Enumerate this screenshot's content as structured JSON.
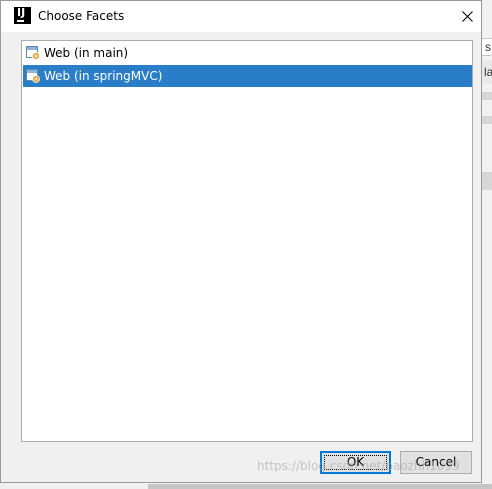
{
  "window": {
    "title": "Choose Facets",
    "app_icon": "intellij-idea-icon",
    "app_icon_text": "IJ"
  },
  "facets": [
    {
      "label": "Web (in main)",
      "icon": "web-facet-icon",
      "selected": false
    },
    {
      "label": "Web (in springMVC)",
      "icon": "web-facet-icon",
      "selected": true
    }
  ],
  "buttons": {
    "ok_label": "OK",
    "cancel_label": "Cancel"
  },
  "background_window": {
    "fragment_1": "s",
    "fragment_2": "la"
  },
  "watermark": "https://blog.csdn.net/baozhh1099",
  "colors": {
    "selection": "#2a7ec7",
    "default_button_border": "#0078d7",
    "dialog_background": "#f0f0f0"
  }
}
